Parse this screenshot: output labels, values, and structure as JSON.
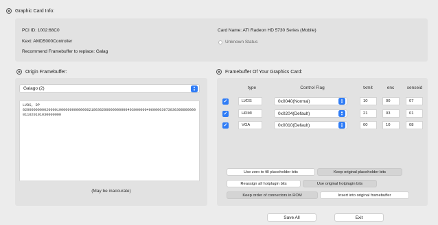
{
  "graphic_card_info": {
    "title": "Graphic Card Info:",
    "pci_id": "PCI ID: 1002:68C0",
    "kext": "Kext:  AMD5000Controller",
    "recommend": "Recommend Framebuffer to replace: Galag",
    "card_name": "Card Name: ATI Radeon HD 5730 Series (Mobile)",
    "status": "Unknown Status"
  },
  "origin_framebuffer": {
    "title": "Origin Framebuffer:",
    "selected": "Galago (2)",
    "text": "LVDS, DP\n020000000002000019000000000000021003020000000000040300000040600003073030300000000011020101030000000",
    "note": "(May be inaccurate)"
  },
  "framebuffer_card": {
    "title": "Framebuffer Of Your Graphics Card:",
    "headers": {
      "type": "type",
      "control_flag": "Control Flag",
      "txmit": "txmit",
      "enc": "enc",
      "senseid": "senseid"
    },
    "rows": [
      {
        "checked": true,
        "type": "LVDS",
        "flag": "0x0040(Normal)",
        "txmit": "10",
        "enc": "00",
        "senseid": "07"
      },
      {
        "checked": true,
        "type": "HDMI",
        "flag": "0x0204(Default)",
        "txmit": "21",
        "enc": "03",
        "senseid": "01"
      },
      {
        "checked": true,
        "type": "VGA",
        "flag": "0x0010(Default)",
        "txmit": "00",
        "enc": "10",
        "senseid": "08"
      }
    ],
    "buttons": {
      "zero_fill": "Use zero to fill placeholder bits",
      "keep_placeholder": "Keep original placeholder bits",
      "reassign_hotplug": "Reassign all hotplugin bits",
      "use_hotplug": "Use original hotplugin bits",
      "keep_order": "Keep order of connectors in ROM",
      "insert_original": "Insert into original framebuffer"
    }
  },
  "footer": {
    "save_all": "Save All",
    "exit": "Exit"
  },
  "colors": {
    "accent": "#2f7cf6",
    "background": "#ececec",
    "panel": "#e2e2e2"
  }
}
